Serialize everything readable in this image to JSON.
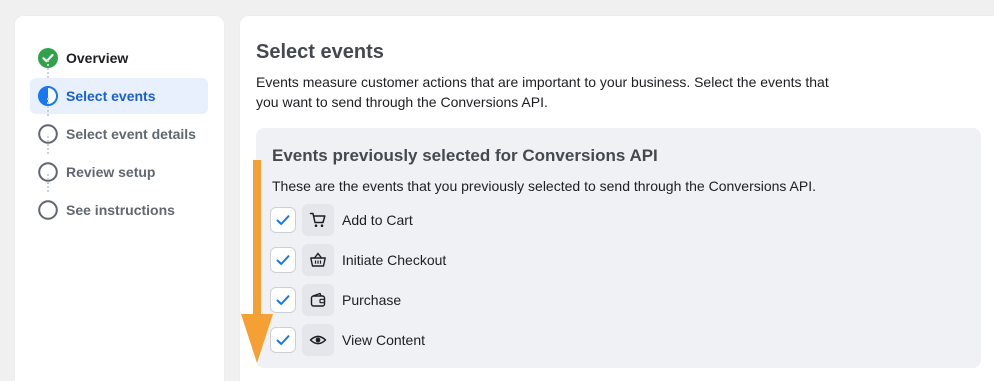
{
  "sidebar": {
    "steps": [
      {
        "label": "Overview",
        "state": "done"
      },
      {
        "label": "Select events",
        "state": "active"
      },
      {
        "label": "Select event details",
        "state": "pending"
      },
      {
        "label": "Review setup",
        "state": "pending"
      },
      {
        "label": "See instructions",
        "state": "pending"
      }
    ]
  },
  "main": {
    "title": "Select events",
    "description": "Events measure customer actions that are important to your business. Select the events that you want to send through the Conversions API."
  },
  "events_section": {
    "title": "Events previously selected for Conversions API",
    "description": "These are the events that you previously selected to send through the Conversions API.",
    "events": [
      {
        "label": "Add to Cart",
        "icon": "cart-icon",
        "checked": true
      },
      {
        "label": "Initiate Checkout",
        "icon": "basket-icon",
        "checked": true
      },
      {
        "label": "Purchase",
        "icon": "wallet-icon",
        "checked": true
      },
      {
        "label": "View Content",
        "icon": "eye-icon",
        "checked": true
      }
    ]
  },
  "colors": {
    "accent": "#1877f2",
    "success": "#31a24c",
    "annotation_arrow": "#f5a035"
  }
}
